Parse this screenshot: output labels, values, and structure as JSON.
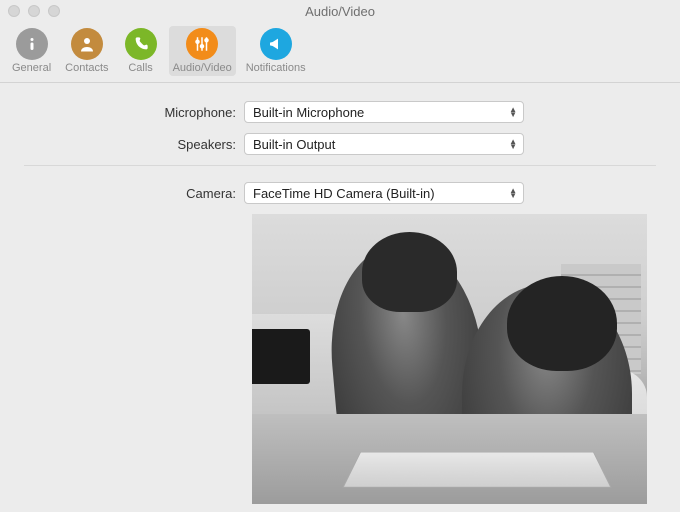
{
  "window": {
    "title": "Audio/Video"
  },
  "toolbar": {
    "items": [
      {
        "label": "General",
        "color": "#9b9b9b",
        "icon": "info"
      },
      {
        "label": "Contacts",
        "color": "#c38b3e",
        "icon": "contacts"
      },
      {
        "label": "Calls",
        "color": "#7cb728",
        "icon": "phone"
      },
      {
        "label": "Audio/Video",
        "color": "#f28c1a",
        "icon": "sliders",
        "active": true
      },
      {
        "label": "Notifications",
        "color": "#1ea7e0",
        "icon": "megaphone"
      }
    ]
  },
  "settings": {
    "microphone": {
      "label": "Microphone:",
      "value": "Built-in Microphone"
    },
    "speakers": {
      "label": "Speakers:",
      "value": "Built-in Output"
    },
    "camera": {
      "label": "Camera:",
      "value": "FaceTime HD Camera (Built-in)"
    }
  }
}
